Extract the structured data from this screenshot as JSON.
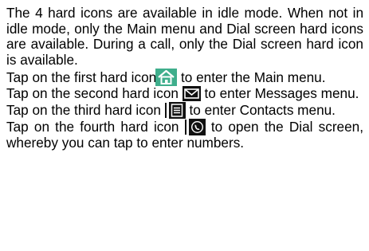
{
  "intro": "The 4 hard icons are available in idle mode. When not in idle mode, only the Main menu and Dial screen hard icons are available. During a call, only the Dial screen hard icon is available.",
  "items": [
    {
      "before": "Tap on the first hard icon",
      "icon": "home-icon",
      "after": " to enter the Main menu."
    },
    {
      "before": "Tap on the second hard icon ",
      "icon": "envelope-icon",
      "after": " to enter Messages menu."
    },
    {
      "before": "Tap on the third hard icon ",
      "icon": "contacts-book-icon",
      "after": " to enter Contacts menu."
    },
    {
      "before": "Tap on the fourth hard icon ",
      "icon": "phone-dial-icon",
      "after": " to open the Dial screen, whereby you can tap to enter numbers."
    }
  ],
  "colors": {
    "icon_fill": "#111111",
    "icon_accent": "#3fae8c",
    "text": "#000000"
  }
}
